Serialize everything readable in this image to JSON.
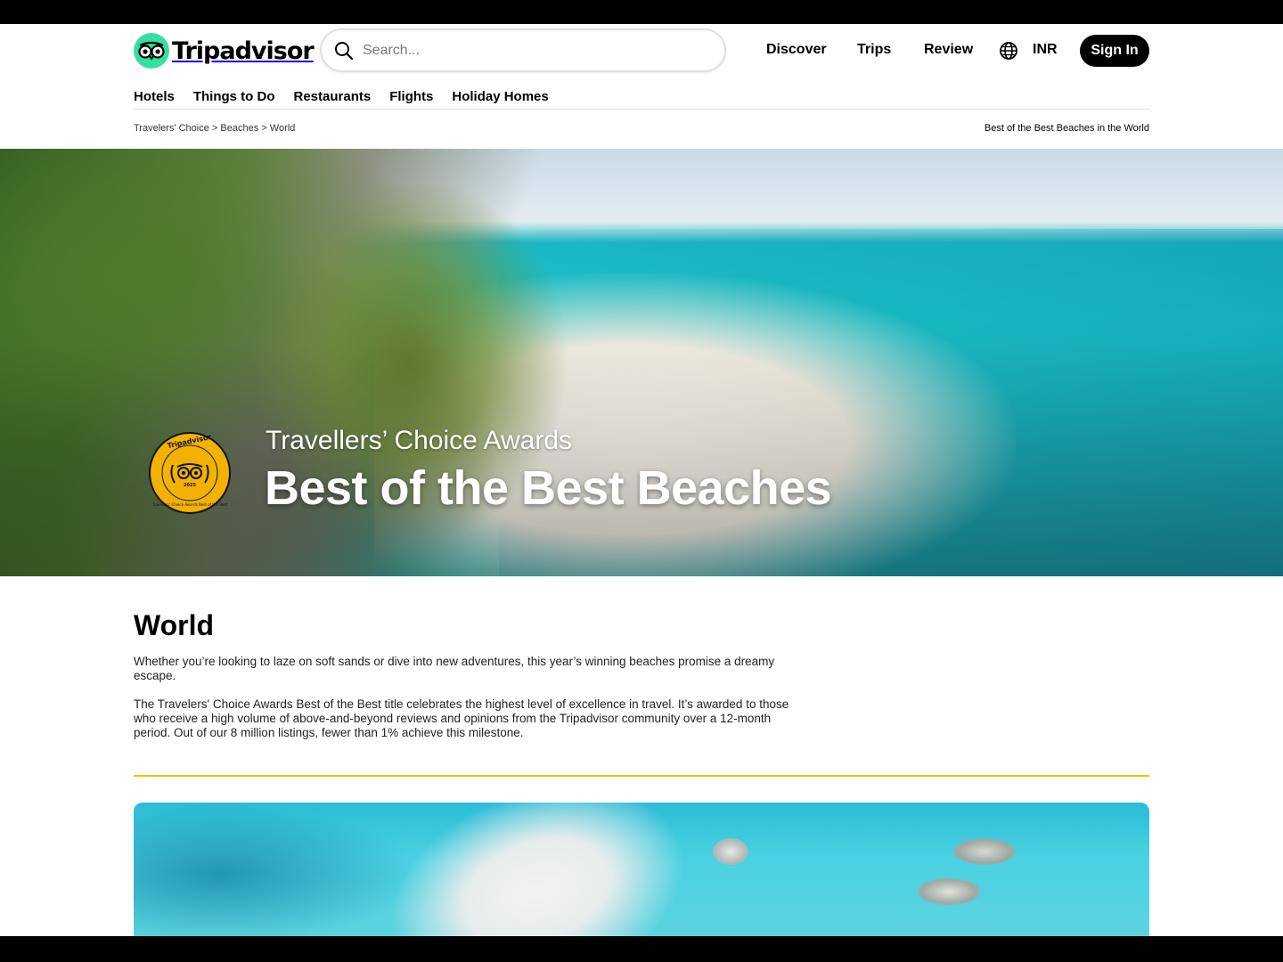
{
  "header": {
    "brand": "Tripadvisor",
    "search_placeholder": "Search...",
    "nav": [
      "Discover",
      "Trips",
      "Review"
    ],
    "currency": "INR",
    "signin_label": "Sign In"
  },
  "subnav": [
    "Hotels",
    "Things to Do",
    "Restaurants",
    "Flights",
    "Holiday Homes"
  ],
  "breadcrumb": {
    "items": [
      "Travelers' Choice",
      "Beaches",
      "World"
    ],
    "separator": ">",
    "right_text": "Best of the Best Beaches in the World"
  },
  "hero": {
    "kicker": "Travellers’ Choice Awards",
    "title": "Best of the Best Beaches",
    "badge": {
      "brand": "Tripadvisor",
      "year": "2025",
      "caption": "Travellers' Choice Awards Best of the Best"
    }
  },
  "content": {
    "title": "World",
    "paragraph1": "Whether you’re looking to laze on soft sands or dive into new adventures, this year’s winning beaches promise a dreamy escape.",
    "paragraph2": "The Travelers' Choice Awards Best of the Best title celebrates the highest level of excellence in travel. It’s awarded to those who receive a high volume of above-and-beyond reviews and opinions from the Tripadvisor community over a 12-month period. Out of our 8 million listings, fewer than 1% achieve this milestone."
  },
  "colors": {
    "brand_green": "#34e0a1",
    "accent_gold": "#f2c200",
    "badge_gold": "#f2b203",
    "button_black": "#000000"
  }
}
